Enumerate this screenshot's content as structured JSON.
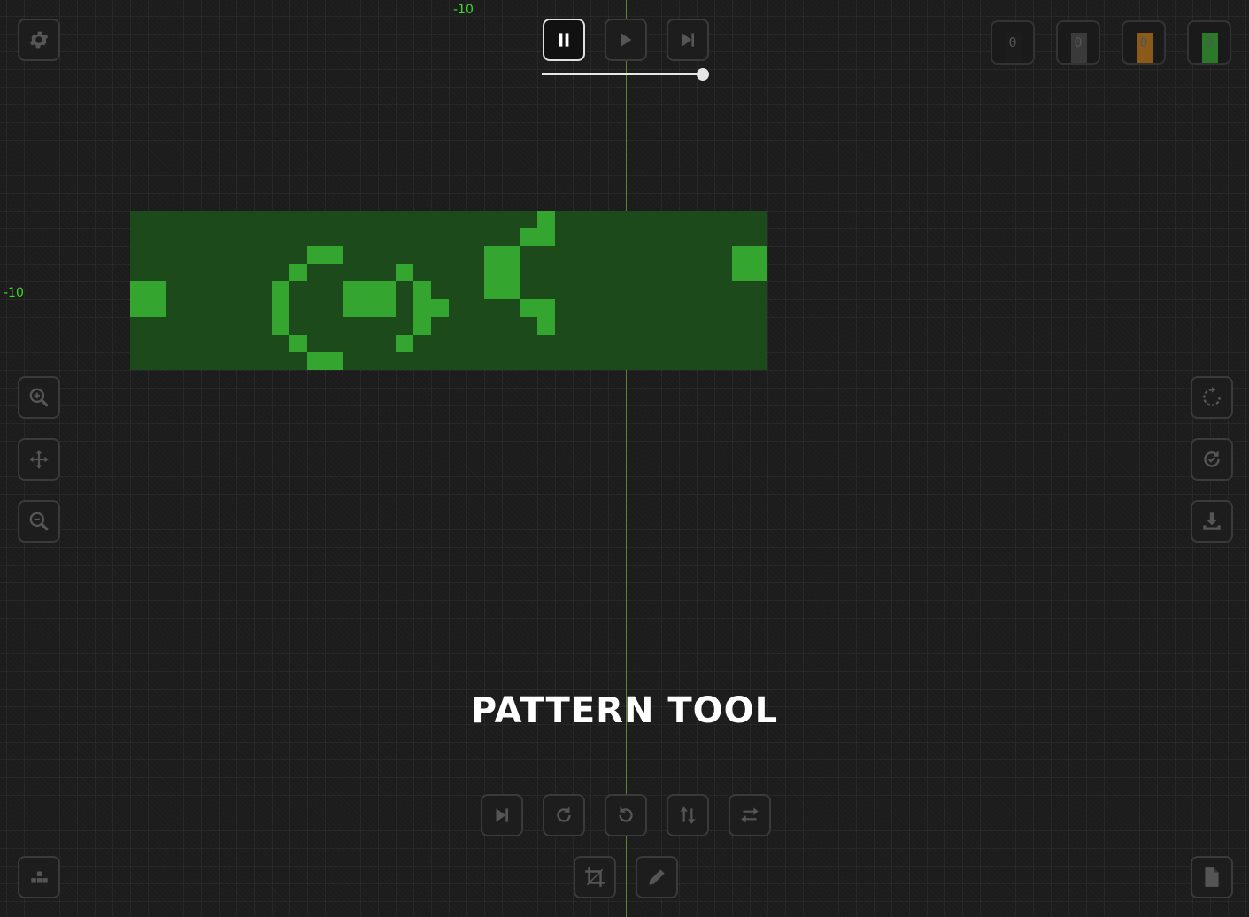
{
  "coords": {
    "top_label": "-10",
    "left_label": "-10"
  },
  "playback": {
    "pause_icon": "pause-icon",
    "play_icon": "play-icon",
    "step_icon": "step-forward-icon",
    "speed": 1.0
  },
  "counters": [
    {
      "value": "0",
      "color": "#1c1c1c"
    },
    {
      "value": "0",
      "color": "#3a3a3a"
    },
    {
      "value": "0",
      "color": "#8a5a18"
    },
    {
      "value": "0",
      "color": "#2a7a2a"
    }
  ],
  "tool_title": "PATTERN TOOL",
  "colors": {
    "cell": "#34a52e",
    "pattern_area": "#1d4a1b",
    "axis": "#7fd63a",
    "coord_label": "#3ddc2f"
  },
  "icons": {
    "settings": "gear-icon",
    "zoom_in": "zoom-in-icon",
    "pan": "move-icon",
    "zoom_out": "zoom-out-icon",
    "reset": "reset-icon",
    "refresh": "refresh-icon",
    "download": "download-icon",
    "patterns": "grid-dots-icon",
    "file": "file-icon",
    "bottom_tools": [
      "step-forward-icon",
      "rotate-cw-icon",
      "rotate-ccw-icon",
      "flip-vertical-icon",
      "flip-horizontal-icon"
    ],
    "crop": "crop-icon",
    "pencil": "pencil-icon"
  },
  "live_cells": [
    [
      0,
      4
    ],
    [
      1,
      4
    ],
    [
      0,
      5
    ],
    [
      1,
      5
    ],
    [
      12,
      4
    ],
    [
      13,
      4
    ],
    [
      14,
      4
    ],
    [
      12,
      5
    ],
    [
      13,
      5
    ],
    [
      14,
      5
    ],
    [
      10,
      2
    ],
    [
      11,
      2
    ],
    [
      9,
      3
    ],
    [
      8,
      4
    ],
    [
      8,
      5
    ],
    [
      8,
      6
    ],
    [
      9,
      7
    ],
    [
      10,
      8
    ],
    [
      11,
      8
    ],
    [
      15,
      3
    ],
    [
      16,
      4
    ],
    [
      16,
      5
    ],
    [
      17,
      5
    ],
    [
      16,
      6
    ],
    [
      15,
      7
    ],
    [
      20,
      2
    ],
    [
      21,
      2
    ],
    [
      20,
      3
    ],
    [
      21,
      3
    ],
    [
      20,
      4
    ],
    [
      21,
      4
    ],
    [
      22,
      1
    ],
    [
      23,
      0
    ],
    [
      23,
      1
    ],
    [
      22,
      5
    ],
    [
      23,
      5
    ],
    [
      23,
      6
    ],
    [
      34,
      2
    ],
    [
      35,
      2
    ],
    [
      34,
      3
    ],
    [
      35,
      3
    ]
  ]
}
